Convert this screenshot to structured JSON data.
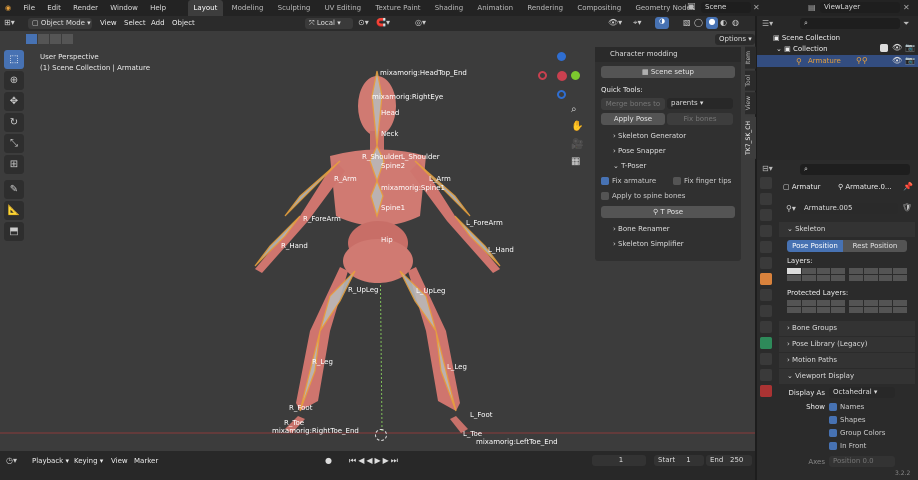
{
  "menu": [
    "File",
    "Edit",
    "Render",
    "Window",
    "Help"
  ],
  "workspaces": [
    "Layout",
    "Modeling",
    "Sculpting",
    "UV Editing",
    "Texture Paint",
    "Shading",
    "Animation",
    "Rendering",
    "Compositing",
    "Geometry Nodes",
    "Scripting"
  ],
  "scene": "Scene",
  "view_layer": "ViewLayer",
  "viewport_header": {
    "mode": "Object Mode",
    "menus": [
      "View",
      "Select",
      "Add",
      "Object"
    ],
    "orientation": "Local",
    "options": "Options"
  },
  "viewport": {
    "title": "User Perspective",
    "subtitle": "(1) Scene Collection | Armature"
  },
  "bones": [
    {
      "name": "mixamorig:HeadTop_End"
    },
    {
      "name": "mixamorig:RightEye"
    },
    {
      "name": "Head"
    },
    {
      "name": "Neck"
    },
    {
      "name": "R_Shoulder"
    },
    {
      "name": "L_Shoulder"
    },
    {
      "name": "Spine2"
    },
    {
      "name": "R_Arm"
    },
    {
      "name": "L_Arm"
    },
    {
      "name": "mixamorig:Spine1"
    },
    {
      "name": "Spine1"
    },
    {
      "name": "R_ForeArm"
    },
    {
      "name": "L_ForeArm"
    },
    {
      "name": "Hip"
    },
    {
      "name": "R_Hand"
    },
    {
      "name": "L_Hand"
    },
    {
      "name": "R_UpLeg"
    },
    {
      "name": "L_UpLeg"
    },
    {
      "name": "R_Leg"
    },
    {
      "name": "L_Leg"
    },
    {
      "name": "R_Foot"
    },
    {
      "name": "L_Foot"
    },
    {
      "name": "R_Toe"
    },
    {
      "name": "mixamorig:RightToe_End"
    },
    {
      "name": "L_Toe"
    },
    {
      "name": "mixamorig:LeftToe_End"
    }
  ],
  "npanel": {
    "title": "Character modding",
    "scene_setup": "Scene setup",
    "quick_tools": "Quick Tools:",
    "merge_bones": "Merge bones to",
    "merge_target": "parents",
    "apply_pose": "Apply Pose",
    "fix_bones": "Fix bones",
    "sections": [
      "Skeleton Generator",
      "Pose Snapper",
      "T-Poser"
    ],
    "fix_armature": "Fix armature",
    "fix_finger_tips": "Fix finger tips",
    "apply_spine": "Apply to spine bones",
    "t_pose": "T Pose",
    "sections2": [
      "Bone Renamer",
      "Skeleton Simplifier"
    ],
    "side_tabs": [
      "Item",
      "Tool",
      "View",
      "TK7_SK_CH"
    ]
  },
  "outliner": {
    "scene_collection": "Scene Collection",
    "collection": "Collection",
    "armature": "Armature"
  },
  "properties": {
    "object_name": "Armatur",
    "data_name": "Armature.0...",
    "datablock": "Armature.005",
    "skeleton": "Skeleton",
    "pose_position": "Pose Position",
    "rest_position": "Rest Position",
    "layers": "Layers:",
    "protected_layers": "Protected Layers:",
    "panels": [
      "Bone Groups",
      "Pose Library (Legacy)",
      "Motion Paths"
    ],
    "viewport_display": "Viewport Display",
    "display_as_label": "Display As",
    "display_as": "Octahedral",
    "show_label": "Show",
    "show_items": [
      "Names",
      "Shapes",
      "Group Colors",
      "In Front"
    ],
    "axes": "Axes",
    "position": "Position",
    "position_value": "0.0",
    "version": "3.2.2"
  },
  "timeline": {
    "menus": [
      "Playback",
      "Keying",
      "View",
      "Marker"
    ],
    "current_frame": "1",
    "start_label": "Start",
    "start": "1",
    "end_label": "End",
    "end": "250"
  },
  "colors": {
    "accent": "#4772b3",
    "body": "#d07a72",
    "bone_orange": "#e8a13c"
  }
}
